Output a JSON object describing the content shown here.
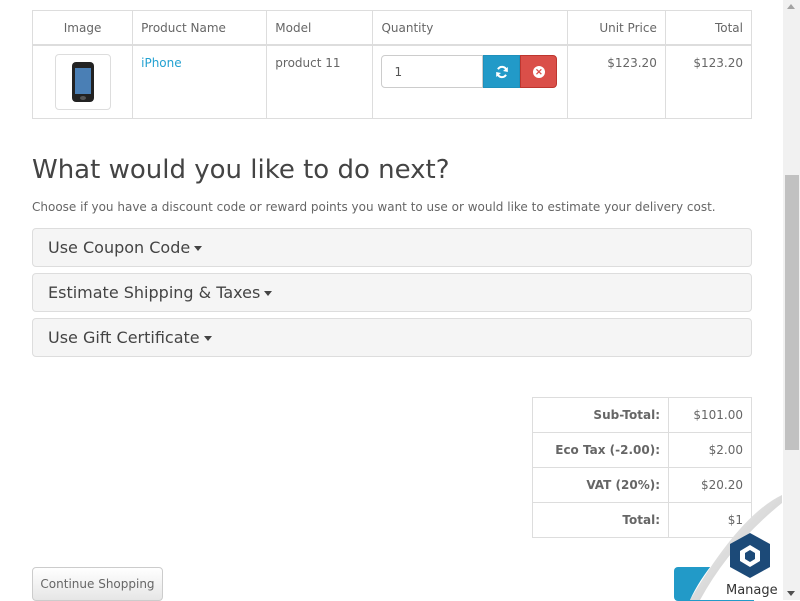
{
  "cart": {
    "headers": {
      "image": "Image",
      "name": "Product Name",
      "model": "Model",
      "quantity": "Quantity",
      "unit_price": "Unit Price",
      "total": "Total"
    },
    "items": [
      {
        "name": "iPhone",
        "model": "product 11",
        "quantity": "1",
        "unit_price": "$123.20",
        "total": "$123.20"
      }
    ]
  },
  "next": {
    "heading": "What would you like to do next?",
    "intro": "Choose if you have a discount code or reward points you want to use or would like to estimate your delivery cost.",
    "panels": [
      "Use Coupon Code",
      "Estimate Shipping & Taxes",
      "Use Gift Certificate"
    ]
  },
  "totals": [
    {
      "label": "Sub-Total:",
      "value": "$101.00"
    },
    {
      "label": "Eco Tax (-2.00):",
      "value": "$2.00"
    },
    {
      "label": "VAT (20%):",
      "value": "$20.20"
    },
    {
      "label": "Total:",
      "value": "$1"
    }
  ],
  "buttons": {
    "continue": "Continue Shopping"
  },
  "overlay": {
    "manage": "Manage"
  },
  "colors": {
    "accent": "#23a1d1",
    "update_button": "#229ac8",
    "remove_button": "#da4f49"
  },
  "icons": {
    "update": "refresh-icon",
    "remove": "times-circle-icon",
    "dropdown": "caret-down-icon",
    "manage": "cube-logo-icon"
  }
}
